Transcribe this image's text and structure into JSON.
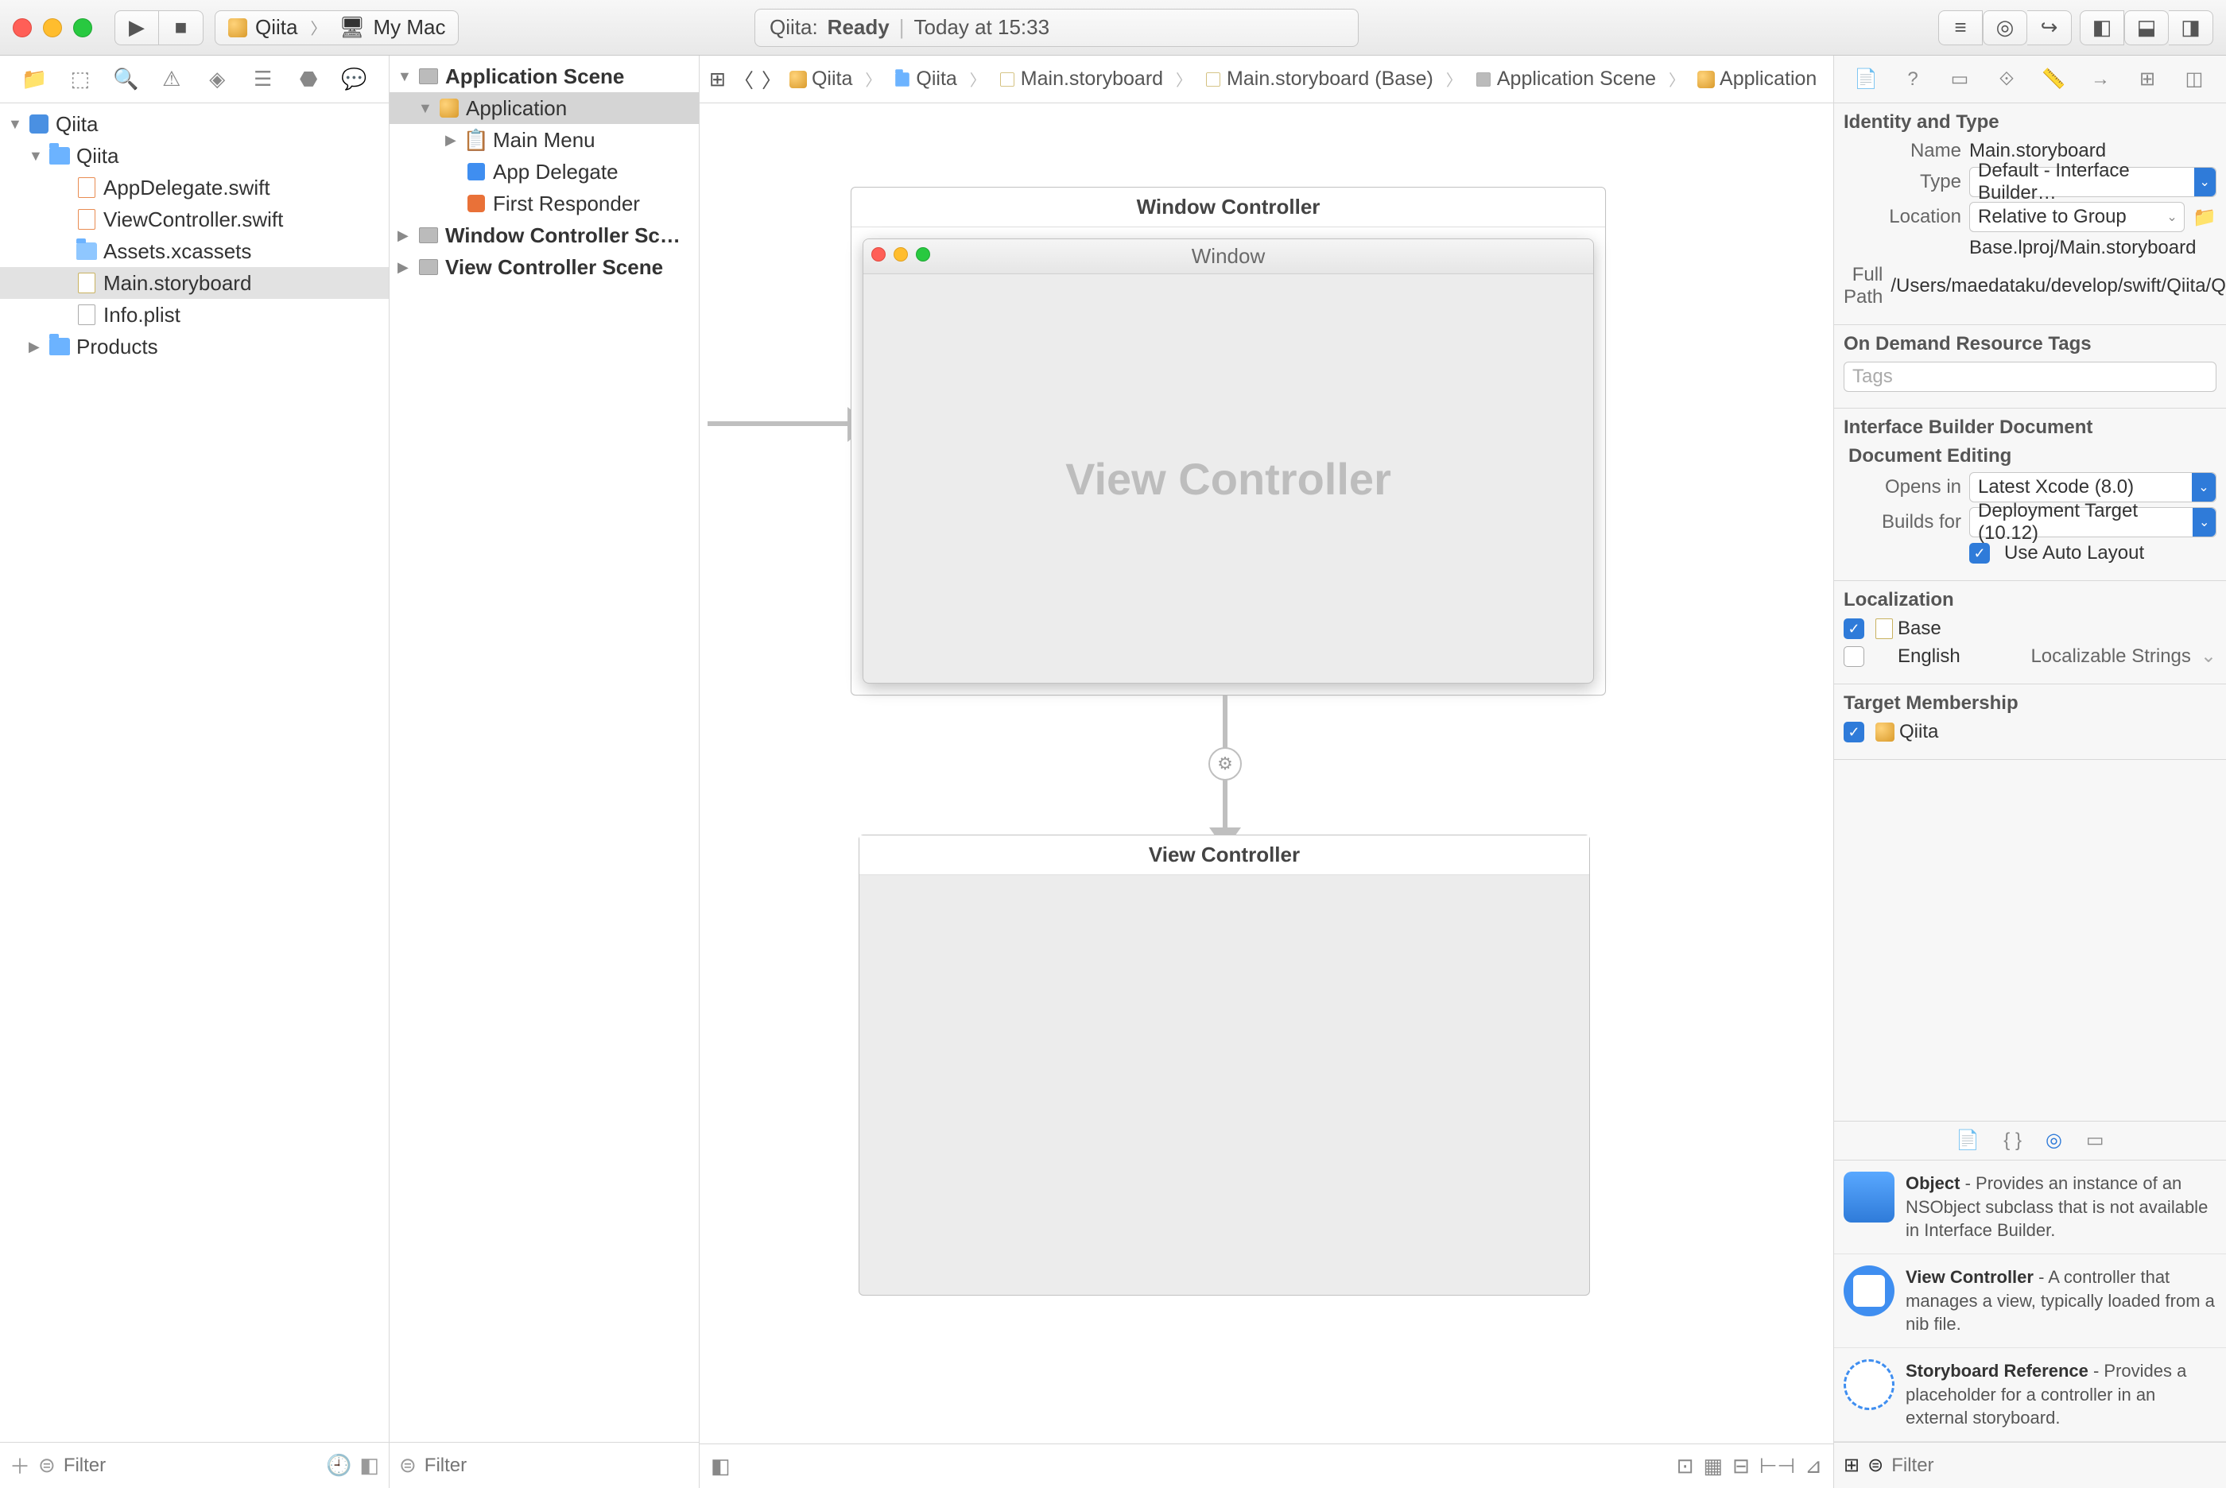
{
  "titlebar": {
    "scheme_target": "Qiita",
    "scheme_device": "My Mac",
    "status_prefix": "Qiita:",
    "status_state": "Ready",
    "status_time": "Today at 15:33"
  },
  "navigator": {
    "root": "Qiita",
    "group": "Qiita",
    "files": [
      "AppDelegate.swift",
      "ViewController.swift",
      "Assets.xcassets",
      "Main.storyboard",
      "Info.plist"
    ],
    "products": "Products",
    "filter_placeholder": "Filter"
  },
  "outline": {
    "items": {
      "app_scene": "Application Scene",
      "application": "Application",
      "main_menu": "Main Menu",
      "app_delegate": "App Delegate",
      "first_responder": "First Responder",
      "window_controller_scene": "Window Controller Sc…",
      "view_controller_scene": "View Controller Scene"
    },
    "filter_placeholder": "Filter"
  },
  "jumpbar": {
    "segments": [
      "Qiita",
      "Qiita",
      "Main.storyboard",
      "Main.storyboard (Base)",
      "Application Scene",
      "Application"
    ]
  },
  "canvas": {
    "window_controller": "Window Controller",
    "window": "Window",
    "view_controller_embedded": "View Controller",
    "view_controller": "View Controller"
  },
  "inspector": {
    "identity_title": "Identity and Type",
    "name_label": "Name",
    "name_value": "Main.storyboard",
    "type_label": "Type",
    "type_value": "Default - Interface Builder…",
    "location_label": "Location",
    "location_value": "Relative to Group",
    "location_path": "Base.lproj/Main.storyboard",
    "fullpath_label": "Full Path",
    "fullpath_value": "/Users/maedataku/develop/swift/Qiita/Qiita/Base.lproj/Main.storyboard",
    "odr_title": "On Demand Resource Tags",
    "odr_placeholder": "Tags",
    "ibdoc_title": "Interface Builder Document",
    "doc_editing": "Document Editing",
    "opensin_label": "Opens in",
    "opensin_value": "Latest Xcode (8.0)",
    "buildsfor_label": "Builds for",
    "buildsfor_value": "Deployment Target (10.12)",
    "autolayout_label": "Use Auto Layout",
    "localization_title": "Localization",
    "loc_base": "Base",
    "loc_english": "English",
    "loc_english_kind": "Localizable Strings",
    "target_title": "Target Membership",
    "target_name": "Qiita"
  },
  "library": {
    "items": [
      {
        "name": "Object",
        "desc": " - Provides an instance of an NSObject subclass that is not available in Interface Builder."
      },
      {
        "name": "View Controller",
        "desc": " - A controller that manages a view, typically loaded from a nib file."
      },
      {
        "name": "Storyboard Reference",
        "desc": " - Provides a placeholder for a controller in an external storyboard."
      }
    ],
    "filter_placeholder": "Filter"
  }
}
